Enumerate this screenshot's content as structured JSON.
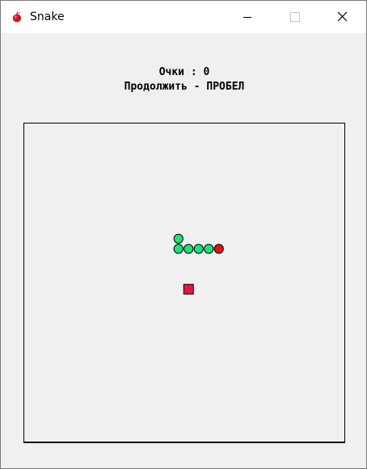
{
  "window": {
    "title": "Snake",
    "app_icon": "apple-icon",
    "controls": [
      "minimize-icon",
      "maximize-icon",
      "close-icon"
    ]
  },
  "hud": {
    "score_text": "Очки : 0",
    "hint_text": "Продолжить - ПРОБЕЛ"
  },
  "game": {
    "paused": true,
    "grid_cell": 12.5,
    "snake": {
      "head_color": "#e8100e",
      "body_color": "#1fe07a",
      "head": [
        19,
        12
      ],
      "body": [
        [
          18,
          12
        ],
        [
          17,
          12
        ],
        [
          16,
          12
        ],
        [
          15,
          12
        ],
        [
          15,
          11
        ]
      ]
    },
    "food": {
      "color": "#e8173e",
      "cell": [
        16,
        16
      ]
    }
  },
  "colors": {
    "window_bg": "#f0f0f0",
    "titlebar_bg": "#ffffff",
    "board_border": "#000000"
  }
}
